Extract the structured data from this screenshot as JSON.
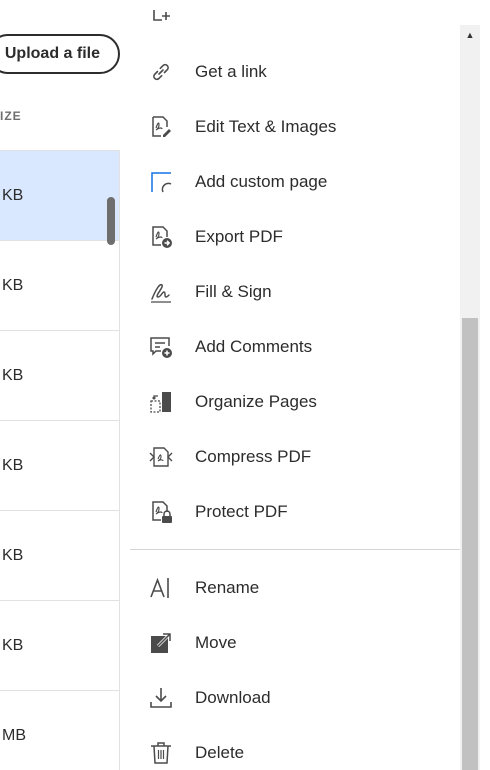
{
  "file_panel": {
    "upload_button": "Upload a file",
    "size_column_header": "IZE",
    "rows": [
      {
        "size": "KB",
        "selected": true
      },
      {
        "size": "KB",
        "selected": false
      },
      {
        "size": "KB",
        "selected": false
      },
      {
        "size": "KB",
        "selected": false
      },
      {
        "size": "KB",
        "selected": false
      },
      {
        "size": "KB",
        "selected": false
      },
      {
        "size": "MB",
        "selected": false
      }
    ]
  },
  "menu": {
    "items": [
      {
        "label": "Get a link",
        "icon": "link-icon"
      },
      {
        "label": "Edit Text & Images",
        "icon": "edit-pdf-icon"
      },
      {
        "label": "Add custom page",
        "icon": "add-page-icon"
      },
      {
        "label": "Export PDF",
        "icon": "export-pdf-icon"
      },
      {
        "label": "Fill & Sign",
        "icon": "fill-sign-icon"
      },
      {
        "label": "Add Comments",
        "icon": "add-comment-icon"
      },
      {
        "label": "Organize Pages",
        "icon": "organize-pages-icon"
      },
      {
        "label": "Compress PDF",
        "icon": "compress-pdf-icon"
      },
      {
        "label": "Protect PDF",
        "icon": "protect-pdf-icon"
      },
      {
        "label": "Rename",
        "icon": "rename-icon"
      },
      {
        "label": "Move",
        "icon": "move-icon"
      },
      {
        "label": "Download",
        "icon": "download-icon"
      },
      {
        "label": "Delete",
        "icon": "trash-icon"
      }
    ]
  },
  "colors": {
    "selected_row": "#d9e8ff",
    "text": "#2c2c2c",
    "icon": "#4b4b4b",
    "accent": "#1473e6"
  }
}
